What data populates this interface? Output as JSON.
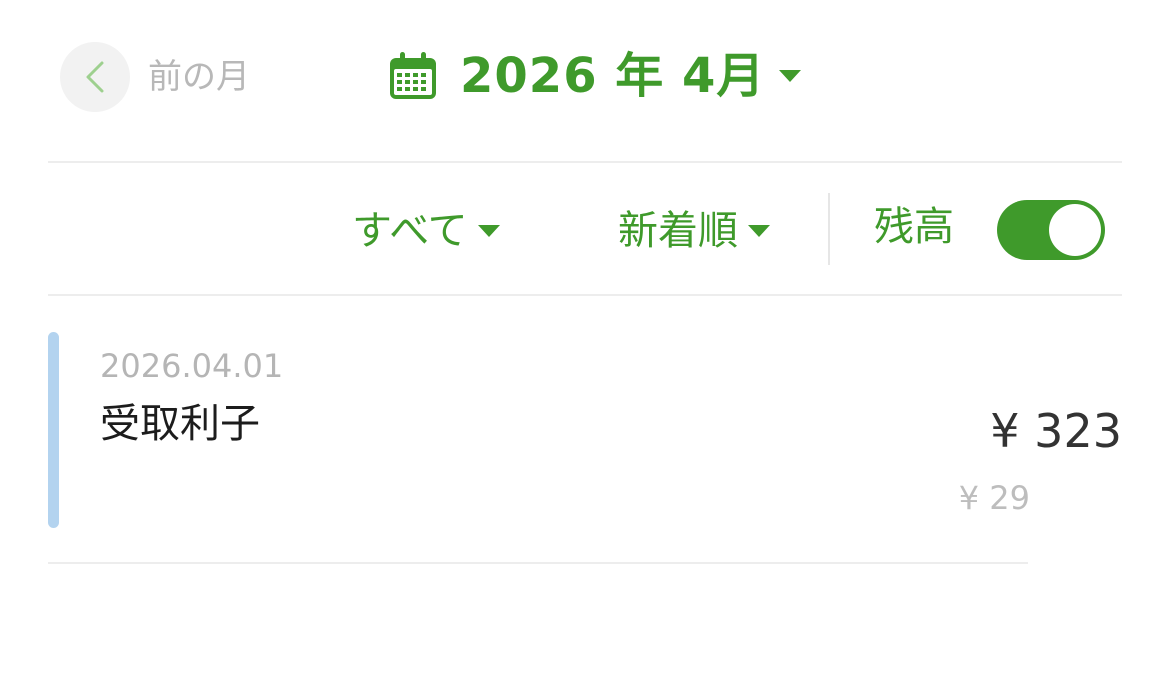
{
  "header": {
    "prev_label": "前の月",
    "month_label": "2026 年 4月"
  },
  "filters": {
    "all_label": "すべて",
    "sort_label": "新着順",
    "balance_label": "残高",
    "balance_toggle_on": true
  },
  "transactions": [
    {
      "date": "2026.04.01",
      "title": "受取利子",
      "amount": "¥ 323",
      "balance": "¥ 29"
    }
  ],
  "colors": {
    "accent": "#3f9a2b",
    "indicator": "#b3d3ef"
  }
}
